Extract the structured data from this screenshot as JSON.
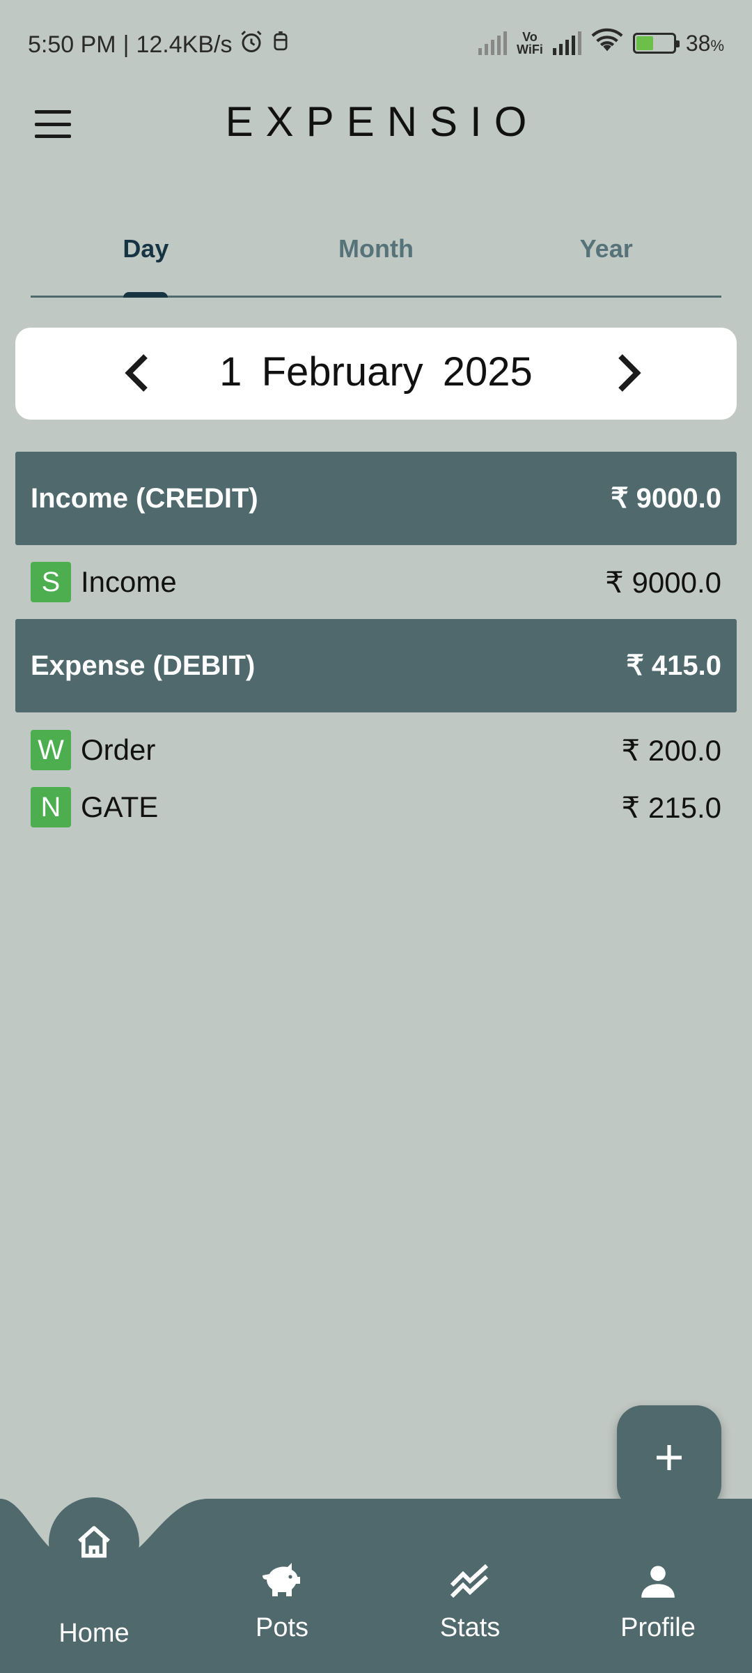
{
  "status_bar": {
    "time": "5:50 PM",
    "net_speed": "12.4KB/s",
    "vowifi_top": "Vo",
    "vowifi_bottom": "WiFi",
    "battery": "38",
    "battery_unit": "%"
  },
  "app": {
    "title": "EXPENSIO"
  },
  "tabs": [
    {
      "label": "Day",
      "active": true
    },
    {
      "label": "Month",
      "active": false
    },
    {
      "label": "Year",
      "active": false
    }
  ],
  "date_selector": {
    "day": "1",
    "month": "February",
    "year": "2025"
  },
  "income": {
    "header_label": "Income (CREDIT)",
    "header_total": "₹ 9000.0",
    "items": [
      {
        "badge": "S",
        "name": "Income",
        "amount": "₹ 9000.0"
      }
    ]
  },
  "expense": {
    "header_label": "Expense (DEBIT)",
    "header_total": "₹ 415.0",
    "items": [
      {
        "badge": "W",
        "name": "Order",
        "amount": "₹ 200.0"
      },
      {
        "badge": "N",
        "name": "GATE",
        "amount": "₹ 215.0"
      }
    ]
  },
  "fab": {
    "icon": "plus-icon"
  },
  "bottom_nav": {
    "items": [
      {
        "label": "Home",
        "icon": "home-icon",
        "active": true
      },
      {
        "label": "Pots",
        "icon": "piggy-bank-icon"
      },
      {
        "label": "Stats",
        "icon": "trending-icon"
      },
      {
        "label": "Profile",
        "icon": "person-icon"
      }
    ]
  },
  "colors": {
    "background": "#c0c8c4",
    "primary": "#4f696c",
    "badge": "#4cae4f",
    "active_tab": "#173442"
  }
}
